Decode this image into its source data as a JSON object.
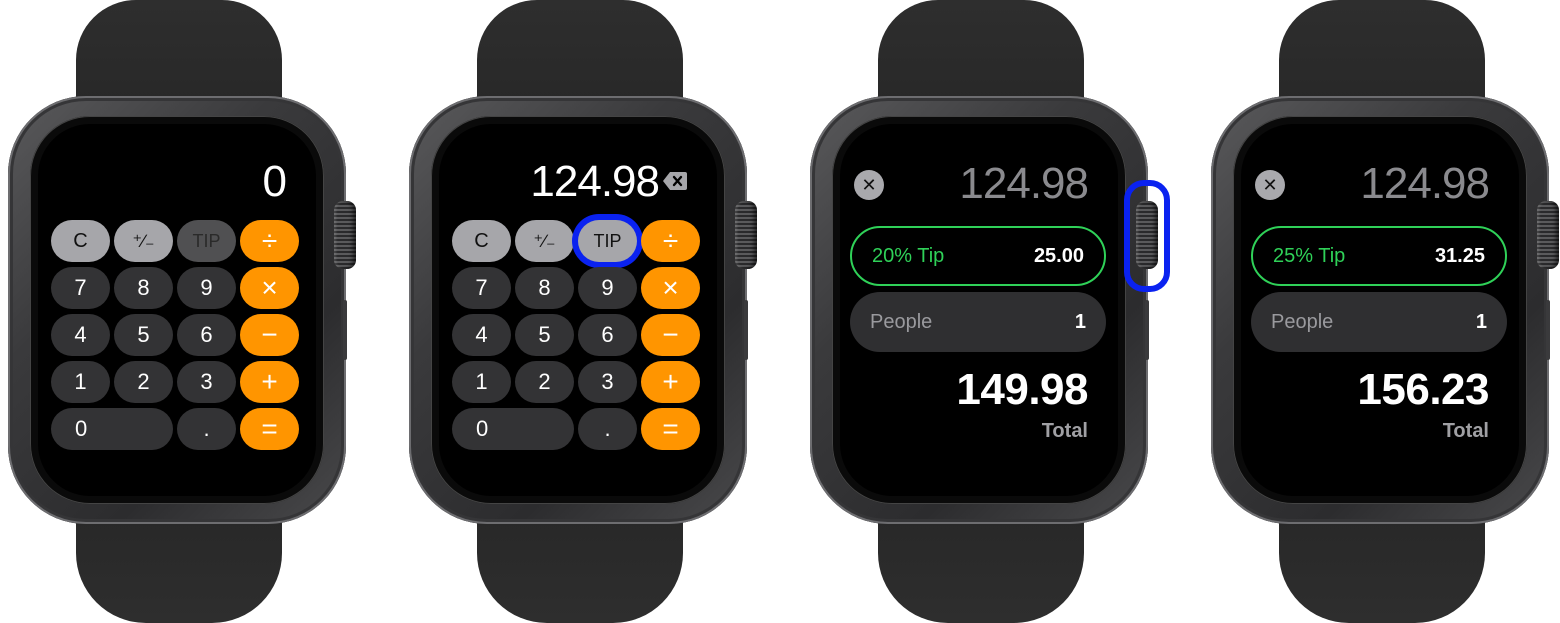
{
  "colors": {
    "operator_key": "#ff9500",
    "function_key": "#a6a6aa",
    "digit_key": "#333335",
    "tip_accent": "#2fd158",
    "highlight": "#0a22f0",
    "background": "#ffffff"
  },
  "watches": [
    {
      "id": "watch-1",
      "screen": "calculator",
      "display_value": "0",
      "keys": {
        "clear": "C",
        "sign": "⁺∕₋",
        "tip": "TIP",
        "divide": "÷",
        "multiply": "×",
        "subtract": "−",
        "add": "+",
        "equals": "=",
        "d7": "7",
        "d8": "8",
        "d9": "9",
        "d4": "4",
        "d5": "5",
        "d6": "6",
        "d1": "1",
        "d2": "2",
        "d3": "3",
        "d0": "0",
        "decimal": "."
      },
      "tip_enabled": false
    },
    {
      "id": "watch-2",
      "screen": "calculator",
      "display_value": "124.98",
      "delete_icon": "backspace-icon",
      "keys": {
        "clear": "C",
        "sign": "⁺∕₋",
        "tip": "TIP",
        "divide": "÷",
        "multiply": "×",
        "subtract": "−",
        "add": "+",
        "equals": "=",
        "d7": "7",
        "d8": "8",
        "d9": "9",
        "d4": "4",
        "d5": "5",
        "d6": "6",
        "d1": "1",
        "d2": "2",
        "d3": "3",
        "d0": "0",
        "decimal": "."
      },
      "tip_enabled": true,
      "highlighted": "tip-button"
    },
    {
      "id": "watch-3",
      "screen": "tip",
      "close_icon": "close-icon",
      "base_amount": "124.98",
      "tip_label": "20% Tip",
      "tip_amount": "25.00",
      "people_label": "People",
      "people_count": "1",
      "total_value": "149.98",
      "total_label": "Total",
      "highlighted": "digital-crown"
    },
    {
      "id": "watch-4",
      "screen": "tip",
      "close_icon": "close-icon",
      "base_amount": "124.98",
      "tip_label": "25% Tip",
      "tip_amount": "31.25",
      "people_label": "People",
      "people_count": "1",
      "total_value": "156.23",
      "total_label": "Total"
    }
  ]
}
